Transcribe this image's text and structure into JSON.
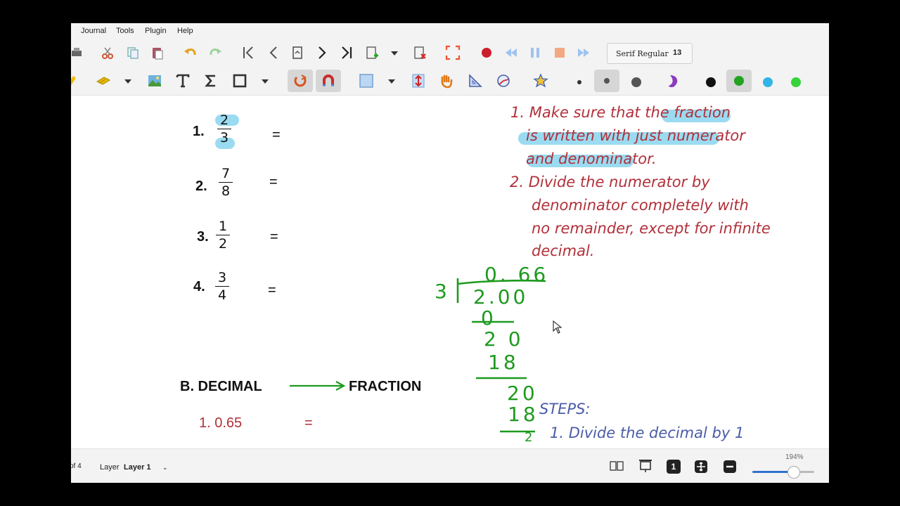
{
  "menu": {
    "journal": "Journal",
    "tools": "Tools",
    "plugin": "Plugin",
    "help": "Help"
  },
  "toolbar": {
    "font_name": "Serif Regular",
    "font_size": "13"
  },
  "colors": {
    "black": "#111111",
    "green": "#21a321",
    "light_blue": "#31b4e6",
    "light_green": "#35d43a",
    "accent_red": "#b1303a"
  },
  "content": {
    "items": [
      {
        "num": "1.",
        "numerator": "2",
        "denominator": "3",
        "eq": "="
      },
      {
        "num": "2.",
        "numerator": "7",
        "denominator": "8",
        "eq": "="
      },
      {
        "num": "3.",
        "numerator": "1",
        "denominator": "2",
        "eq": "="
      },
      {
        "num": "4.",
        "numerator": "3",
        "denominator": "4",
        "eq": "="
      }
    ],
    "steps_red": [
      "1. Make sure that the fraction",
      "is written with just numerator",
      "and denominator.",
      "2. Divide the numerator by",
      "denominator completely with",
      "no remainder, except for infinite",
      "decimal."
    ],
    "section_b": {
      "left": "B. DECIMAL",
      "right": "FRACTION"
    },
    "b_item": {
      "label": "1. 0.65",
      "eq": "="
    },
    "steps_blue": {
      "title": "STEPS:",
      "step1": "1. Divide the decimal by 1"
    },
    "handwriting": {
      "divisor": "3",
      "quotient": "0. 66",
      "dividend": "2.00",
      "r1": "0",
      "r2": "2 0",
      "r3": "18",
      "r4": "20",
      "r5": "18",
      "r6": "2"
    }
  },
  "status": {
    "page_of": "of 4",
    "layer_label": "Layer",
    "layer_value": "Layer 1",
    "zoom": "194%",
    "page_badge": "1"
  }
}
